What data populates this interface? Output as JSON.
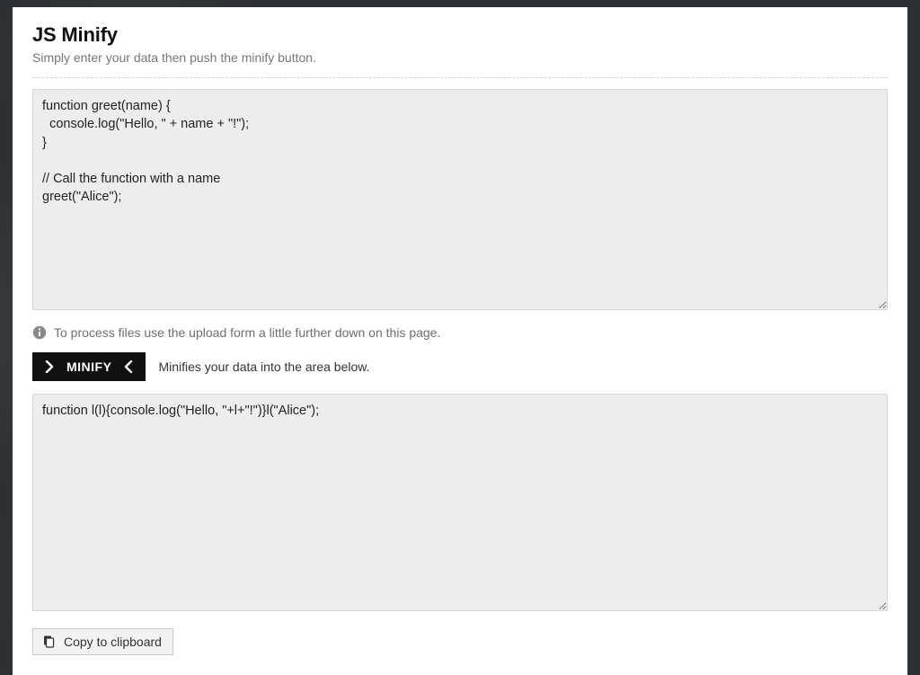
{
  "header": {
    "title": "JS Minify",
    "subtitle": "Simply enter your data then push the minify button."
  },
  "input": {
    "value": "function greet(name) {\n  console.log(\"Hello, \" + name + \"!\");\n}\n\n// Call the function with a name\ngreet(\"Alice\");"
  },
  "hint": {
    "text": "To process files use the upload form a little further down on this page."
  },
  "action": {
    "button_label": "MINIFY",
    "description": "Minifies your data into the area below."
  },
  "output": {
    "value": "function l(l){console.log(\"Hello, \"+l+\"!\")}l(\"Alice\");"
  },
  "copy": {
    "label": "Copy to clipboard"
  }
}
